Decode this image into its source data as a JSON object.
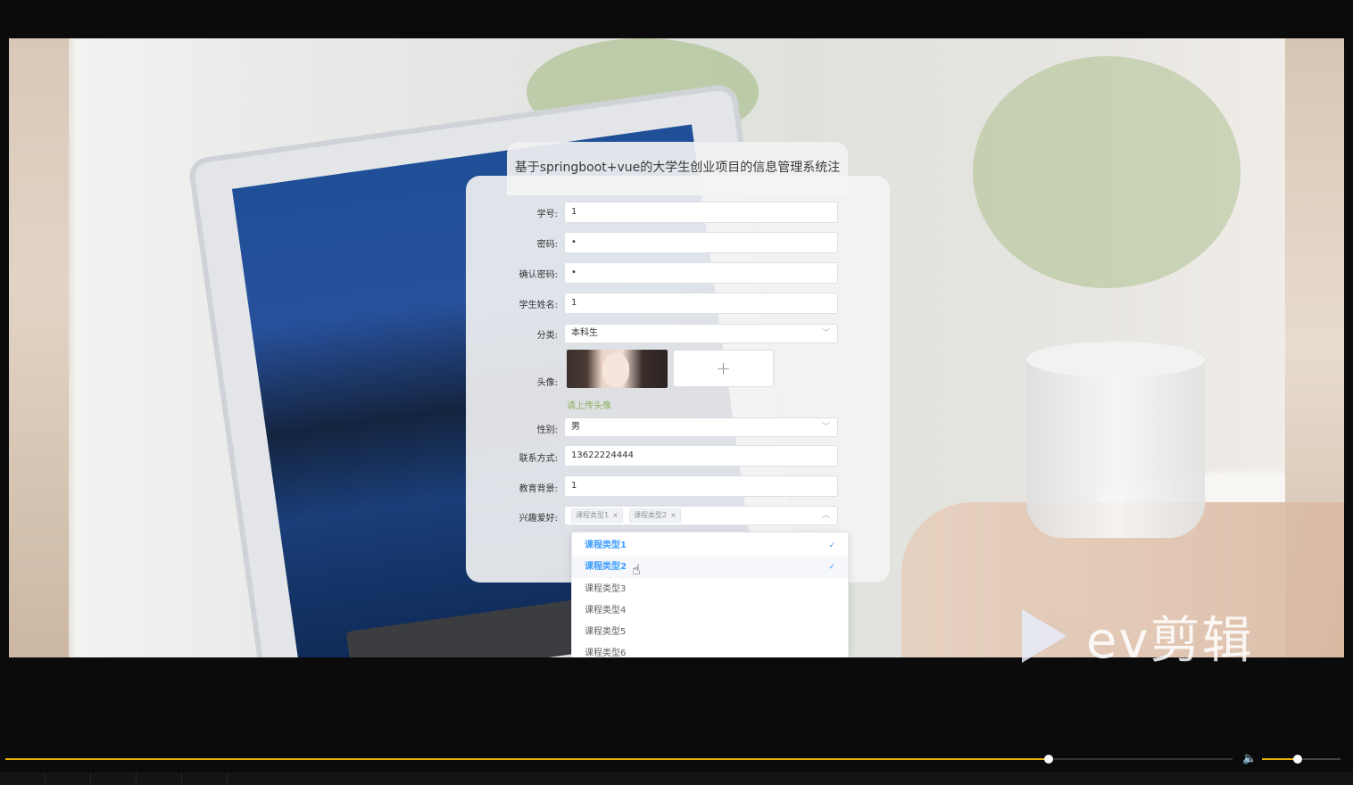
{
  "form": {
    "title": "基于springboot+vue的大学生创业项目的信息管理系统注",
    "fields": {
      "student_id": {
        "label": "学号:",
        "value": "1"
      },
      "password": {
        "label": "密码:",
        "value": "•"
      },
      "confirm_password": {
        "label": "确认密码:",
        "value": "•"
      },
      "student_name": {
        "label": "学生姓名:",
        "value": "1"
      },
      "category": {
        "label": "分类:",
        "value": "本科生"
      },
      "avatar": {
        "label": "头像:",
        "hint": "请上传头像",
        "upload_icon": "+"
      },
      "gender": {
        "label": "性别:",
        "value": "男"
      },
      "contact": {
        "label": "联系方式:",
        "value": "13622224444"
      },
      "education": {
        "label": "教育背景:",
        "value": "1"
      },
      "hobbies": {
        "label": "兴趣爱好:",
        "tags": [
          "课程类型1",
          "课程类型2"
        ]
      }
    }
  },
  "dropdown": {
    "options": [
      {
        "label": "课程类型1",
        "selected": true
      },
      {
        "label": "课程类型2",
        "selected": true
      },
      {
        "label": "课程类型3",
        "selected": false
      },
      {
        "label": "课程类型4",
        "selected": false
      },
      {
        "label": "课程类型5",
        "selected": false
      },
      {
        "label": "课程类型6",
        "selected": false
      }
    ]
  },
  "watermark": {
    "text": "ev剪辑"
  },
  "player": {
    "progress": 0.85,
    "volume": 0.45
  },
  "icons": {
    "close": "×",
    "chevron_down": "﹀",
    "chevron_up": "︿",
    "check": "✓",
    "cursor": "☝",
    "volume": "🔈"
  },
  "colors": {
    "accent": "#409eff",
    "hint": "#8db25e",
    "progress": "#e8b400"
  }
}
